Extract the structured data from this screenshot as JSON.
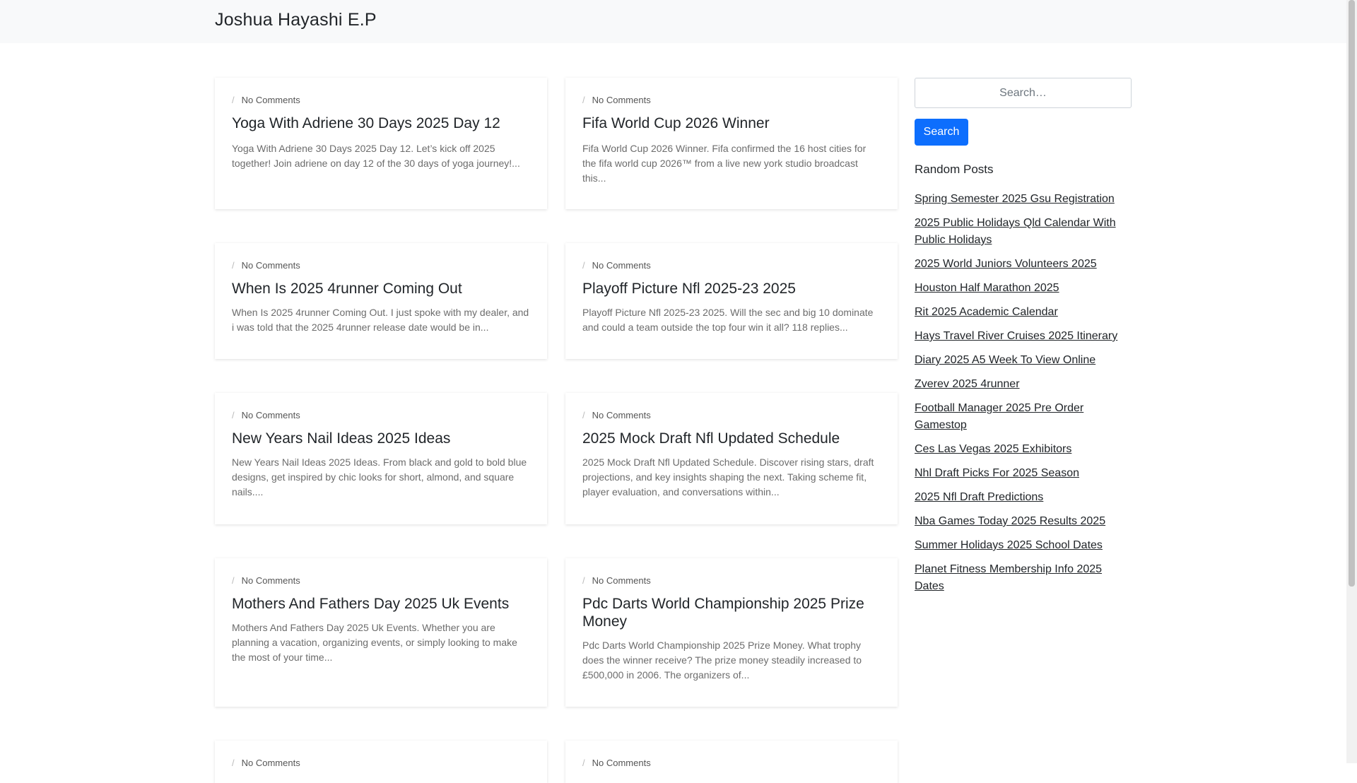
{
  "header": {
    "title": "Joshua Hayashi E.P"
  },
  "posts": [
    {
      "meta": "No Comments",
      "title": "Yoga With Adriene 30 Days 2025 Day 12",
      "excerpt": "Yoga With Adriene 30 Days 2025 Day 12. Let’s kick off 2025 together! Join adriene on day 12 of the 30 days of yoga journey!..."
    },
    {
      "meta": "No Comments",
      "title": "Fifa World Cup 2026 Winner",
      "excerpt": "Fifa World Cup 2026 Winner. Fifa confirmed the 16 host cities for the fifa world cup 2026™ from a live new york studio broadcast this..."
    },
    {
      "meta": "No Comments",
      "title": "When Is 2025 4runner Coming Out",
      "excerpt": "When Is 2025 4runner Coming Out. I just spoke with my dealer, and i was told that the 2025 4runner release date would be in..."
    },
    {
      "meta": "No Comments",
      "title": "Playoff Picture Nfl 2025-23 2025",
      "excerpt": "Playoff Picture Nfl 2025-23 2025. Will the sec and big 10 dominate and could a team outside the top four win it all? 118 replies..."
    },
    {
      "meta": "No Comments",
      "title": "New Years Nail Ideas 2025 Ideas",
      "excerpt": "New Years Nail Ideas 2025 Ideas. From black and gold to bold blue designs, get inspired by chic looks for short, almond, and square nails...."
    },
    {
      "meta": "No Comments",
      "title": "2025 Mock Draft Nfl Updated Schedule",
      "excerpt": "2025 Mock Draft Nfl Updated Schedule. Discover rising stars, draft projections, and key insights shaping the next. Taking scheme fit, player evaluation, and conversations within..."
    },
    {
      "meta": "No Comments",
      "title": "Mothers And Fathers Day 2025 Uk Events",
      "excerpt": "Mothers And Fathers Day 2025 Uk Events. Whether you are planning a vacation, organizing events, or simply looking to make the most of your time..."
    },
    {
      "meta": "No Comments",
      "title": "Pdc Darts World Championship 2025 Prize Money",
      "excerpt": "Pdc Darts World Championship 2025 Prize Money. What trophy does the winner receive? The prize money steadily increased to £500,000 in 2006. The organizers of..."
    },
    {
      "meta": "No Comments"
    },
    {
      "meta": "No Comments"
    }
  ],
  "sidebar": {
    "search_placeholder": "Search…",
    "search_button": "Search",
    "heading": "Random Posts",
    "links": [
      "Spring Semester 2025 Gsu Registration",
      "2025 Public Holidays Qld Calendar With Public Holidays",
      "2025 World Juniors Volunteers 2025",
      "Houston Half Marathon 2025",
      "Rit 2025 Academic Calendar",
      "Hays Travel River Cruises 2025 Itinerary",
      "Diary 2025 A5 Week To View Online",
      "Zverev 2025 4runner",
      "Football Manager 2025 Pre Order Gamestop",
      "Ces Las Vegas 2025 Exhibitors",
      "Nhl Draft Picks For 2025 Season",
      "2025 Nfl Draft Predictions",
      "Nba Games Today 2025 Results 2025",
      "Summer Holidays 2025 School Dates",
      "Planet Fitness Membership Info 2025 Dates"
    ]
  }
}
